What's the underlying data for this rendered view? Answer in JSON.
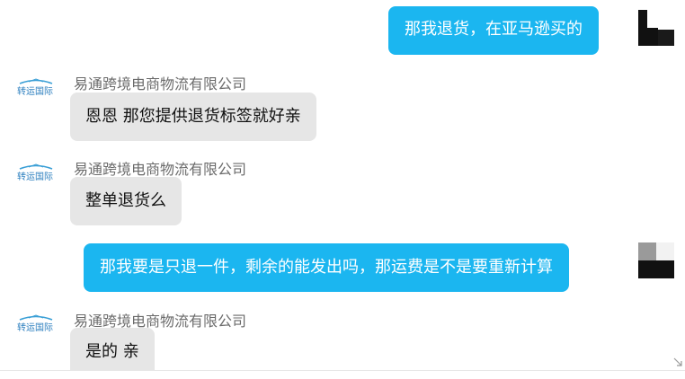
{
  "messages": [
    {
      "direction": "out",
      "text": "那我退货，在亚马逊买的"
    },
    {
      "direction": "in",
      "sender": "易通跨境电商物流有限公司",
      "text": "恩恩  那您提供退货标签就好亲"
    },
    {
      "direction": "in",
      "sender": "易通跨境电商物流有限公司",
      "text": "整单退货么"
    },
    {
      "direction": "out",
      "text": "那我要是只退一件，剩余的能发出吗，那运费是不是要重新计算"
    },
    {
      "direction": "in",
      "sender": "易通跨境电商物流有限公司",
      "text": "是的 亲"
    }
  ],
  "company_avatar_text": "转运国际",
  "colors": {
    "outgoing_bubble": "#1bb6f0",
    "incoming_bubble": "#e6e6e6",
    "sender_name": "#6b6b6b"
  }
}
